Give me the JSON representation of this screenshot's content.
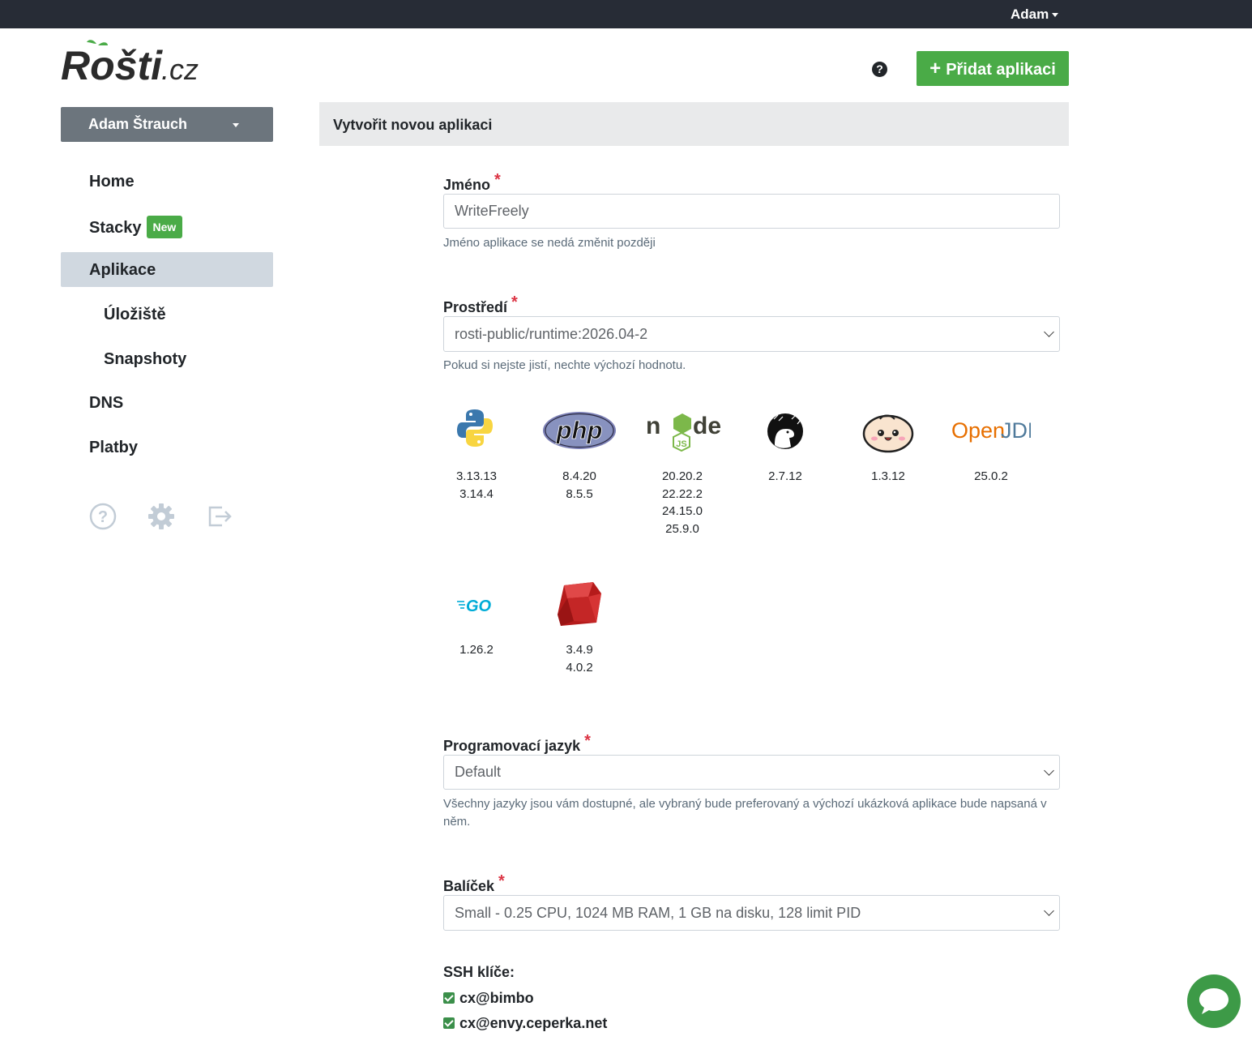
{
  "topbar": {
    "user": "Adam"
  },
  "logo": {
    "text_main": "Rošti",
    "text_tld": ".cz"
  },
  "header": {
    "add_app_label": "Přidat aplikaci",
    "help": "?"
  },
  "sidebar": {
    "account": "Adam Štrauch",
    "items": [
      {
        "label": "Home"
      },
      {
        "label": "Stacky",
        "badge": "New"
      },
      {
        "label": "Aplikace"
      },
      {
        "label": "Úložiště"
      },
      {
        "label": "Snapshoty"
      },
      {
        "label": "DNS"
      },
      {
        "label": "Platby"
      }
    ]
  },
  "form": {
    "title": "Vytvořit novou aplikaci",
    "name": {
      "label": "Jméno",
      "required": "*",
      "value": "WriteFreely",
      "hint": "Jméno aplikace se nedá změnit později"
    },
    "runtime": {
      "label": "Prostředí",
      "required": "*",
      "value": "rosti-public/runtime:2026.04-2",
      "hint": "Pokud si nejste jistí, nechte výchozí hodnotu."
    },
    "runtimes": [
      {
        "icon": "python-icon",
        "versions": [
          "3.13.13",
          "3.14.4"
        ]
      },
      {
        "icon": "php-icon",
        "versions": [
          "8.4.20",
          "8.5.5"
        ]
      },
      {
        "icon": "nodejs-icon",
        "versions": [
          "20.20.2",
          "22.22.2",
          "24.15.0",
          "25.9.0"
        ]
      },
      {
        "icon": "deno-icon",
        "versions": [
          "2.7.12"
        ]
      },
      {
        "icon": "bun-icon",
        "versions": [
          "1.3.12"
        ]
      },
      {
        "icon": "openjdk-icon",
        "versions": [
          "25.0.2"
        ]
      },
      {
        "icon": "go-icon",
        "versions": [
          "1.26.2"
        ]
      },
      {
        "icon": "ruby-icon",
        "versions": [
          "3.4.9",
          "4.0.2"
        ]
      }
    ],
    "language": {
      "label": "Programovací jazyk",
      "required": "*",
      "value": "Default",
      "hint_line1": "Všechny jazyky jsou vám dostupné, ale vybraný bude preferovaný a výchozí ukázková aplikace bude napsaná v",
      "hint_line2": "něm."
    },
    "package": {
      "label": "Balíček",
      "required": "*",
      "value": "Small - 0.25 CPU, 1024 MB RAM, 1 GB na disku, 128 limit PID"
    },
    "ssh": {
      "label": "SSH klíče:",
      "keys": [
        "cx@bimbo",
        "cx@envy.ceperka.net"
      ]
    }
  },
  "brand": {
    "accent": "#4aab47",
    "topbar": "#272c36"
  }
}
